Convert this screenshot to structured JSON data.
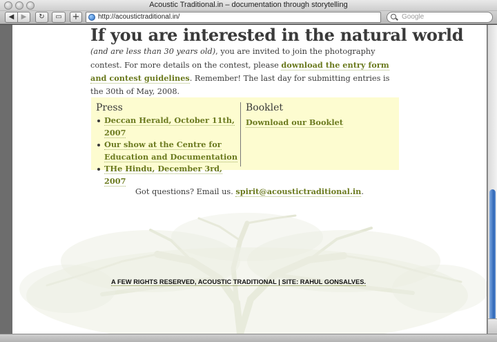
{
  "window": {
    "title": "Acoustic Traditional.in – documentation through storytelling"
  },
  "toolbar": {
    "back_glyph": "◀",
    "forward_glyph": "▶",
    "reload_glyph": "↻",
    "snapshot_glyph": "▭",
    "add_glyph": "+",
    "url": "http://acoustictraditional.in/",
    "search_placeholder": "Google"
  },
  "content": {
    "heading": "If you are interested in the natural world",
    "intro": {
      "italic": "(and are less than 30 years old)",
      "part1": ", you are invited to join the photography contest. For more details on the contest, please ",
      "link": "download the entry form and contest guidelines",
      "part2": ". Remember! The last day for submitting entries is the 30th of May, 2008."
    },
    "press": {
      "title": "Press",
      "items": [
        "Deccan Herald, October 11th, 2007",
        "Our show at the Centre for Education and Documentation",
        "THe Hindu, December 3rd, 2007"
      ]
    },
    "booklet": {
      "title": "Booklet",
      "link": "Download our Booklet"
    },
    "contact": {
      "text": "Got questions? Email us. ",
      "email": "spirit@acoustictraditional.in",
      "end": "."
    },
    "footer": "A FEW RIGHTS RESERVED, ACOUSTIC TRADITIONAL | SITE: RAHUL GONSALVES."
  },
  "colors": {
    "link": "#6b7a1f",
    "panel_bg": "#fdfcd0",
    "tree": "#e3e6d4"
  },
  "icons": {
    "globe": "globe-icon",
    "search": "search-icon"
  }
}
